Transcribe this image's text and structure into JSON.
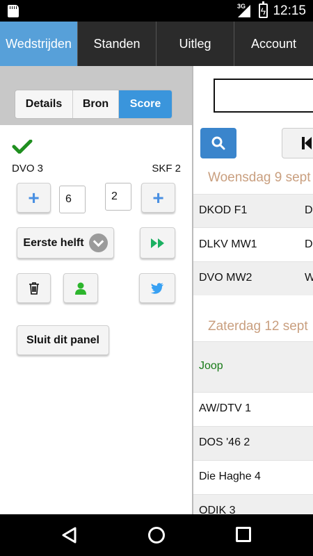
{
  "status": {
    "network": "3G",
    "time": "12:15"
  },
  "tabs": [
    {
      "label": "Wedstrijden",
      "active": true
    },
    {
      "label": "Standen",
      "active": false
    },
    {
      "label": "Uitleg",
      "active": false
    },
    {
      "label": "Account",
      "active": false
    }
  ],
  "segment": {
    "details": "Details",
    "bron": "Bron",
    "score": "Score",
    "selected": "Score"
  },
  "score_panel": {
    "home_team": "DVO 3",
    "away_team": "SKF 2",
    "home_score": "6",
    "away_score": "2",
    "half_select": "Eerste helft",
    "close_label": "Sluit dit panel"
  },
  "schedule": {
    "groups": [
      {
        "date": "Woensdag 9 sept",
        "rows": [
          {
            "team1": "DKOD F1",
            "team2": "D"
          },
          {
            "team1": "DLKV MW1",
            "team2": "D"
          },
          {
            "team1": "DVO MW2",
            "team2": "W"
          }
        ]
      },
      {
        "date": "Zaterdag 12 sept",
        "rows": [
          {
            "team1": "Joop",
            "team2": ""
          },
          {
            "team1": "AW/DTV 1",
            "team2": ""
          },
          {
            "team1": "DOS '46 2",
            "team2": ""
          },
          {
            "team1": "Die Haghe 4",
            "team2": ""
          },
          {
            "team1": "ODIK 3",
            "team2": ""
          }
        ]
      }
    ]
  },
  "colors": {
    "accent": "#3a95dc",
    "active_tab": "#57a0d9",
    "check": "#1f8f1f",
    "date": "#c99f7f",
    "twitter": "#38a1f3",
    "user": "#2db52d"
  },
  "icons": [
    "check-icon",
    "plus-icon",
    "chevron-down-icon",
    "fast-forward-icon",
    "trash-icon",
    "user-icon",
    "twitter-icon",
    "search-icon",
    "skip-first-icon"
  ]
}
